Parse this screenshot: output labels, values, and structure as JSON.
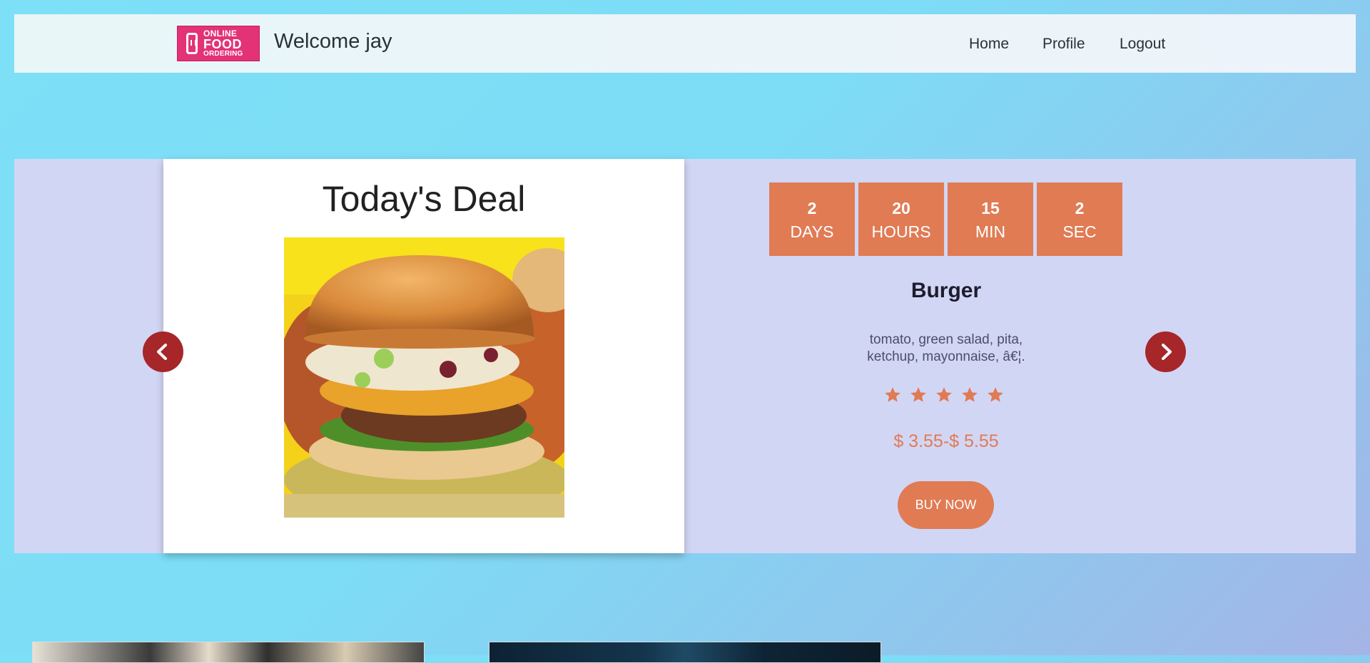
{
  "header": {
    "logo": {
      "line1": "ONLINE",
      "line2": "FOOD",
      "line3": "ORDERING"
    },
    "welcome": "Welcome jay",
    "nav": [
      {
        "label": "Home"
      },
      {
        "label": "Profile"
      },
      {
        "label": "Logout"
      }
    ]
  },
  "deal": {
    "title": "Today's Deal",
    "image": "burger",
    "countdown": [
      {
        "value": "2",
        "label": "DAYS"
      },
      {
        "value": "20",
        "label": "HOURS"
      },
      {
        "value": "15",
        "label": "MIN"
      },
      {
        "value": "2",
        "label": "SEC"
      }
    ],
    "product_name": "Burger",
    "description_line1": "tomato, green salad, pita,",
    "description_line2": "ketchup, mayonnaise, â€¦.",
    "rating": 5,
    "rating_max": 5,
    "price": "$ 3.55-$ 5.55",
    "buy_label": "BUY NOW",
    "prev_icon": "chevron-left-icon",
    "next_icon": "chevron-right-icon"
  },
  "colors": {
    "accent": "#e07b54",
    "arrow": "#a6262a",
    "logo": "#e33275"
  }
}
